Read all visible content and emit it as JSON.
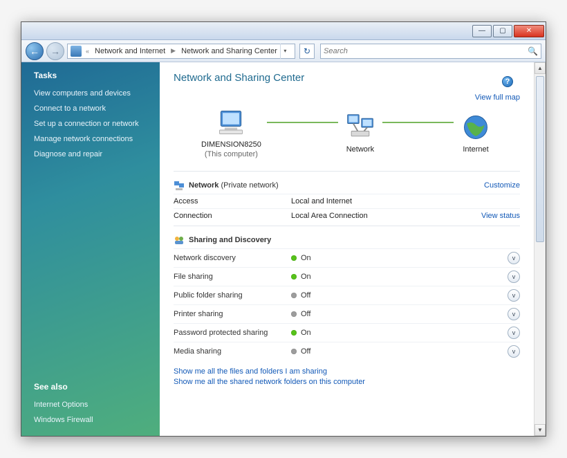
{
  "titlebar": {
    "min": "—",
    "max": "▢",
    "close": "✕"
  },
  "toolbar": {
    "crumb1": "Network and Internet",
    "crumb2": "Network and Sharing Center",
    "search_placeholder": "Search"
  },
  "sidebar": {
    "heading": "Tasks",
    "tasks": [
      "View computers and devices",
      "Connect to a network",
      "Set up a connection or network",
      "Manage network connections",
      "Diagnose and repair"
    ],
    "seealso_heading": "See also",
    "seealso": [
      "Internet Options",
      "Windows Firewall"
    ]
  },
  "page": {
    "title": "Network and Sharing Center",
    "view_full_map": "View full map",
    "node_pc": "DIMENSION8250",
    "node_pc_sub": "(This computer)",
    "node_net": "Network",
    "node_inet": "Internet",
    "sec_network_label": "Network",
    "sec_network_paren": "(Private network)",
    "customize": "Customize",
    "access_label": "Access",
    "access_value": "Local and Internet",
    "conn_label": "Connection",
    "conn_value": "Local Area Connection",
    "view_status": "View status",
    "sd_heading": "Sharing and Discovery",
    "sd_rows": [
      {
        "label": "Network discovery",
        "state": "On",
        "on": true
      },
      {
        "label": "File sharing",
        "state": "On",
        "on": true
      },
      {
        "label": "Public folder sharing",
        "state": "Off",
        "on": false
      },
      {
        "label": "Printer sharing",
        "state": "Off",
        "on": false
      },
      {
        "label": "Password protected sharing",
        "state": "On",
        "on": true
      },
      {
        "label": "Media sharing",
        "state": "Off",
        "on": false
      }
    ],
    "footer_link1": "Show me all the files and folders I am sharing",
    "footer_link2": "Show me all the shared network folders on this computer"
  }
}
